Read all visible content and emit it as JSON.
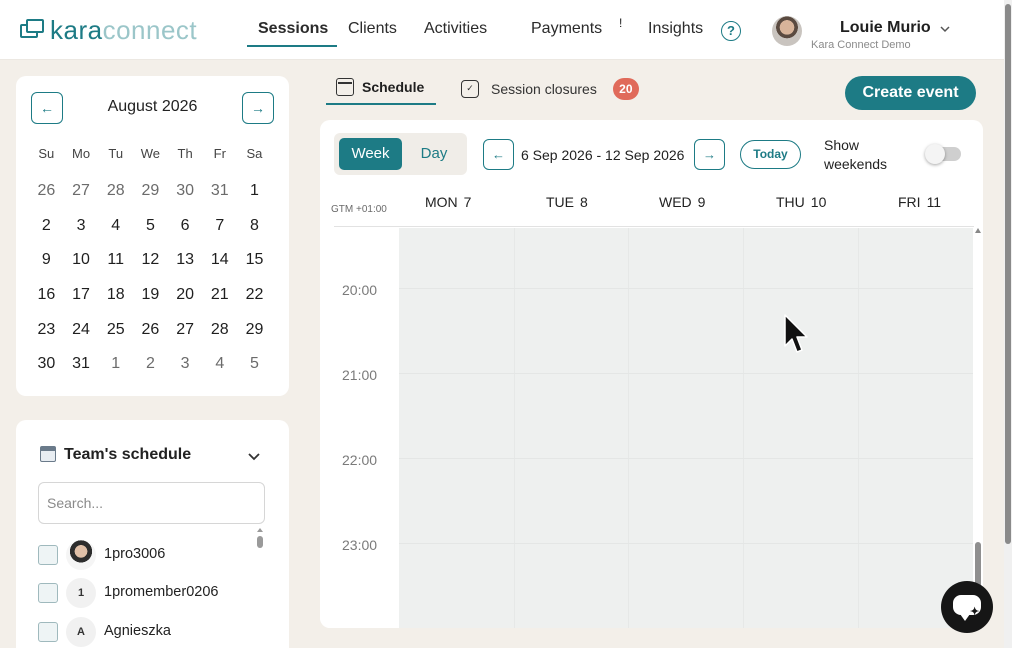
{
  "brand": {
    "part1": "kara",
    "part2": "connect"
  },
  "nav": {
    "sessions": "Sessions",
    "clients": "Clients",
    "activities": "Activities",
    "payments": "Payments",
    "payments_flag": "!",
    "insights": "Insights",
    "help": "?"
  },
  "user": {
    "name": "Louie Murio",
    "org": "Kara Connect Demo"
  },
  "mini_calendar": {
    "prev": "←",
    "next": "→",
    "title": "August 2026",
    "weekdays": [
      "Su",
      "Mo",
      "Tu",
      "We",
      "Th",
      "Fr",
      "Sa"
    ],
    "days": [
      "26",
      "27",
      "28",
      "29",
      "30",
      "31",
      "1",
      "2",
      "3",
      "4",
      "5",
      "6",
      "7",
      "8",
      "9",
      "10",
      "11",
      "12",
      "13",
      "14",
      "15",
      "16",
      "17",
      "18",
      "19",
      "20",
      "21",
      "22",
      "23",
      "24",
      "25",
      "26",
      "27",
      "28",
      "29",
      "30",
      "31",
      "1",
      "2",
      "3",
      "4",
      "5"
    ]
  },
  "team": {
    "title": "Team's schedule",
    "search_placeholder": "Search...",
    "members": [
      {
        "initial": "",
        "name": "1pro3006"
      },
      {
        "initial": "1",
        "name": "1promember0206"
      },
      {
        "initial": "A",
        "name": "Agnieszka"
      }
    ]
  },
  "tabs": {
    "schedule": "Schedule",
    "closures": "Session closures",
    "closures_count": "20"
  },
  "create_event": "Create event",
  "schedule": {
    "view_week": "Week",
    "view_day": "Day",
    "prev": "←",
    "next": "→",
    "range": "6 Sep 2026 - 12 Sep 2026",
    "today": "Today",
    "show_weekends_1": "Show",
    "show_weekends_2": "weekends",
    "show_weekends_on": false,
    "timezone": "GTM +01:00",
    "days": [
      {
        "name": "MON",
        "num": "7"
      },
      {
        "name": "TUE",
        "num": "8"
      },
      {
        "name": "WED",
        "num": "9"
      },
      {
        "name": "THU",
        "num": "10"
      },
      {
        "name": "FRI",
        "num": "11"
      }
    ],
    "times": [
      "20:00",
      "21:00",
      "22:00",
      "23:00"
    ]
  },
  "colors": {
    "accent": "#1d7b85",
    "badge": "#e06a5a",
    "background": "#f3efe9"
  }
}
